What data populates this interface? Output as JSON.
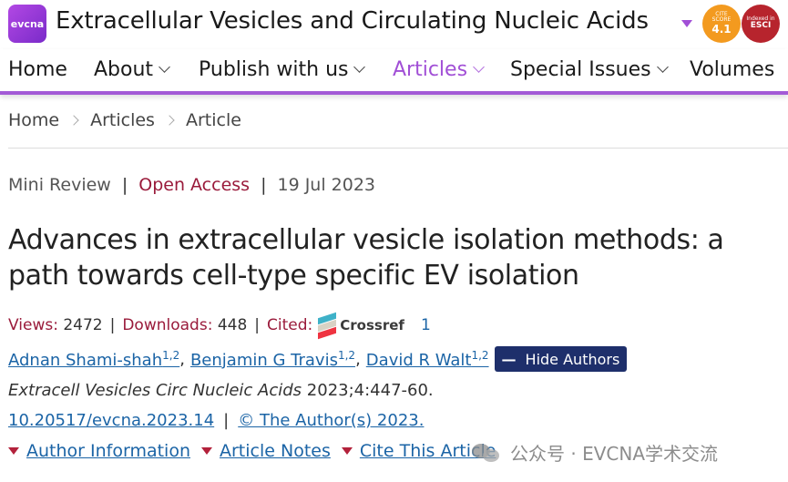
{
  "header": {
    "logo_text": "evcna",
    "journal_title": "Extracellular Vesicles and Circulating Nucleic Acids",
    "cite_score_label_1": "CITE",
    "cite_score_label_2": "SCORE",
    "cite_score_value": "4.1",
    "esci_label": "Indexed in",
    "esci_value": "ESCI"
  },
  "nav": {
    "items": [
      {
        "label": "Home"
      },
      {
        "label": "About"
      },
      {
        "label": "Publish with us"
      },
      {
        "label": "Articles"
      },
      {
        "label": "Special Issues"
      },
      {
        "label": "Volumes"
      }
    ],
    "active": "Articles",
    "accent_color": "#a14fd6"
  },
  "breadcrumb": [
    "Home",
    "Articles",
    "Article"
  ],
  "meta": {
    "type": "Mini Review",
    "access": "Open Access",
    "date": "19 Jul 2023"
  },
  "article": {
    "title": "Advances in extracellular vesicle isolation methods: a path towards cell-type specific EV isolation",
    "views_label": "Views:",
    "views": "2472",
    "downloads_label": "Downloads:",
    "downloads": "448",
    "cited_label": "Cited:",
    "crossref_text": "Crossref",
    "cited_count": "1",
    "authors": [
      {
        "name": "Adnan Shami-shah",
        "aff": "1,2"
      },
      {
        "name": "Benjamin G Travis",
        "aff": "1,2"
      },
      {
        "name": "David R Walt",
        "aff": "1,2"
      }
    ],
    "hide_authors_label": "Hide Authors",
    "citation_journal": "Extracell Vesicles Circ Nucleic Acids",
    "citation_details": " 2023;4:447-60.",
    "doi": "10.20517/evcna.2023.14",
    "copyright": "© The Author(s) 2023."
  },
  "bottom_links": [
    "Author Information",
    "Article Notes",
    "Cite This Article"
  ],
  "watermark": "公众号 · EVCNA学术交流",
  "colors": {
    "link": "#1b64a6",
    "accent_red": "#9a1b3b",
    "button_bg": "#1e2f6b"
  }
}
